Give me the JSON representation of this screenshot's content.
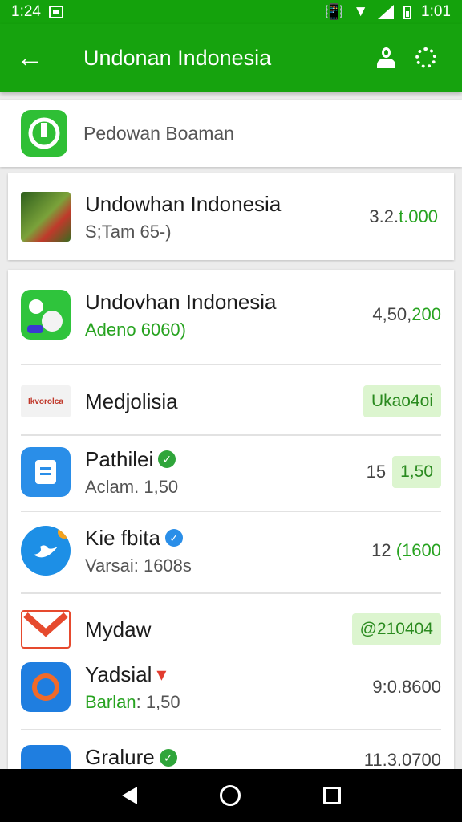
{
  "status": {
    "time_left": "1:24",
    "time_right": "1:01"
  },
  "appbar": {
    "title": "Undonan Indonesia",
    "back_glyph": "←"
  },
  "search": {
    "text": "Pedowan Boaman"
  },
  "featured": {
    "name": "Undowhan Indonesia",
    "sub": "S;Tam 65-)",
    "value": "3.2.",
    "value_accent": "t.000"
  },
  "items": [
    {
      "name": "Undovhan Indonesia",
      "sub": "Adeno 6060)",
      "value": "4,50,",
      "value_accent": "200"
    },
    {
      "name": "Medjolisia",
      "pill": "Ukao4oi",
      "logo_text": "Ikvorolca"
    },
    {
      "name": "Pathilei",
      "sub": "Aclam. 1,50",
      "value": "15",
      "pill": "1,50"
    },
    {
      "name": "Kie fbita",
      "sub_a": "Varsai",
      "sub_b": ": 1608s",
      "value": "12",
      "value_accent": "(1600"
    },
    {
      "name": "Mydaw",
      "pill": "@210404"
    },
    {
      "name": "Yadsial",
      "sub_a": "Barlan",
      "sub_b": ": 1,50",
      "value": "9:0.8600"
    },
    {
      "name": "Gralure",
      "value": "11.3.0700"
    }
  ],
  "colors": {
    "brand": "#16a30e",
    "accent": "#27a320"
  }
}
